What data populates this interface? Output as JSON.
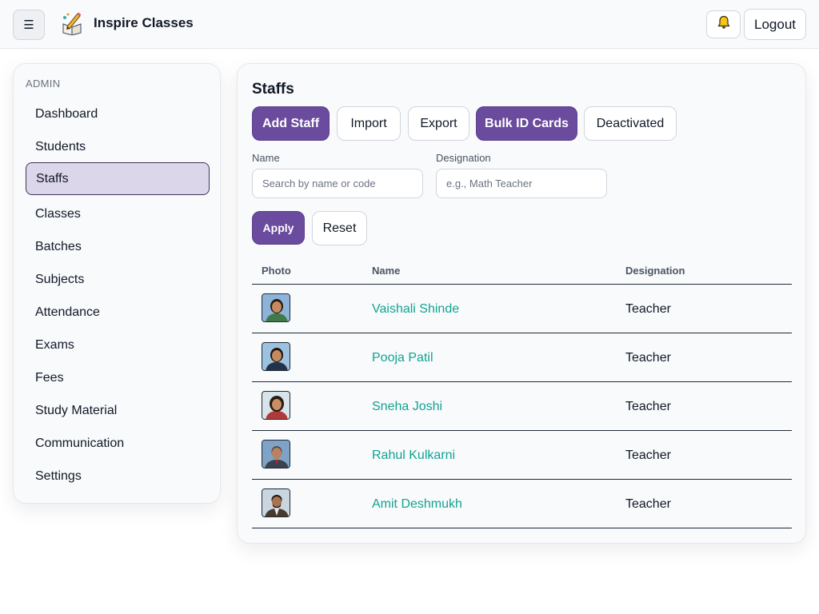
{
  "header": {
    "menu_icon": "☰",
    "logo_icon": "pencil-book-logo-icon",
    "brand": "Inspire Classes",
    "bell_icon": "bell-icon",
    "logout_label": "Logout"
  },
  "sidebar": {
    "heading": "ADMIN",
    "items": [
      {
        "label": "Dashboard"
      },
      {
        "label": "Students"
      },
      {
        "label": "Staffs"
      },
      {
        "label": "Classes"
      },
      {
        "label": "Batches"
      },
      {
        "label": "Subjects"
      },
      {
        "label": "Attendance"
      },
      {
        "label": "Exams"
      },
      {
        "label": "Fees"
      },
      {
        "label": "Study Material"
      },
      {
        "label": "Communication"
      },
      {
        "label": "Settings"
      }
    ],
    "active_item": "Staffs"
  },
  "main": {
    "title": "Staffs",
    "actions": {
      "add_staff": "Add Staff",
      "import": "Import",
      "export": "Export",
      "bulk_id_cards": "Bulk ID Cards",
      "deactivated": "Deactivated"
    },
    "filters": {
      "name_label": "Name",
      "name_placeholder": "Search by name or code",
      "name_value": "",
      "designation_label": "Designation",
      "designation_placeholder": "e.g., Math Teacher",
      "designation_value": "",
      "apply": "Apply",
      "reset": "Reset"
    },
    "table": {
      "headers": {
        "photo": "Photo",
        "name": "Name",
        "designation": "Designation"
      },
      "rows": [
        {
          "name": "Vaishali Shinde",
          "designation": "Teacher"
        },
        {
          "name": "Pooja Patil",
          "designation": "Teacher"
        },
        {
          "name": "Sneha Joshi",
          "designation": "Teacher"
        },
        {
          "name": "Rahul Kulkarni",
          "designation": "Teacher"
        },
        {
          "name": "Amit Deshmukh",
          "designation": "Teacher"
        }
      ]
    }
  },
  "colors": {
    "primary": "#6a4b9e",
    "link": "#14a390",
    "active_nav_bg": "#dcd6ea"
  }
}
